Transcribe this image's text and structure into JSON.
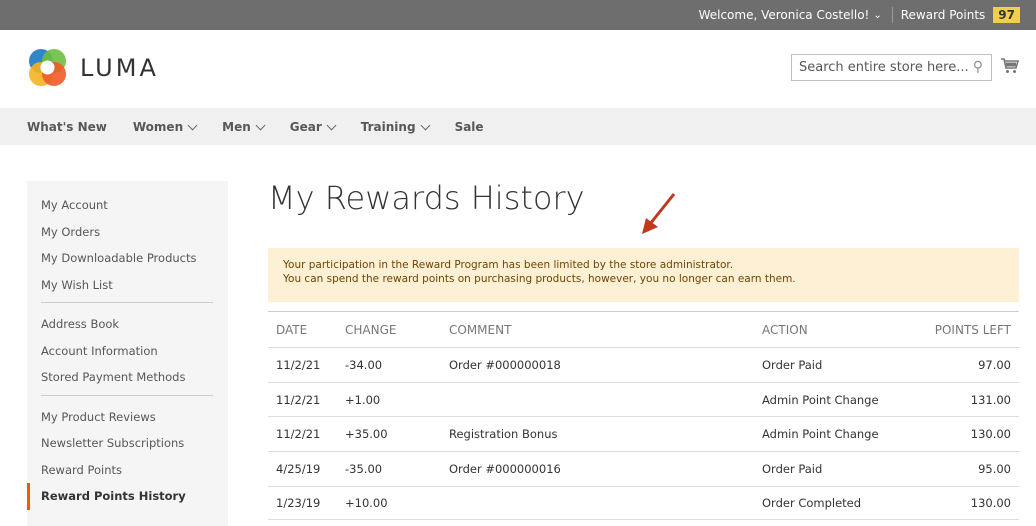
{
  "topbar": {
    "welcome": "Welcome, Veronica Costello!",
    "reward_points_label": "Reward Points",
    "reward_points_value": "97"
  },
  "header": {
    "logo_text": "LUMA",
    "search_placeholder": "Search entire store here..."
  },
  "nav": {
    "items": [
      "What's New",
      "Women",
      "Men",
      "Gear",
      "Training",
      "Sale"
    ]
  },
  "sidebar": {
    "group1": [
      "My Account",
      "My Orders",
      "My Downloadable Products",
      "My Wish List"
    ],
    "group2": [
      "Address Book",
      "Account Information",
      "Stored Payment Methods"
    ],
    "group3": [
      "My Product Reviews",
      "Newsletter Subscriptions",
      "Reward Points",
      "Reward Points History"
    ]
  },
  "main": {
    "title": "My Rewards History",
    "notice_line1": "Your participation in the Reward Program has been limited by the store administrator.",
    "notice_line2": "You can spend the reward points on purchasing products, however, you no longer can earn them."
  },
  "table": {
    "headers": [
      "DATE",
      "CHANGE",
      "COMMENT",
      "ACTION",
      "POINTS LEFT"
    ],
    "rows": [
      {
        "date": "11/2/21",
        "change": "-34.00",
        "comment": "Order #000000018",
        "action": "Order Paid",
        "points": "97.00"
      },
      {
        "date": "11/2/21",
        "change": "+1.00",
        "comment": "",
        "action": "Admin Point Change",
        "points": "131.00"
      },
      {
        "date": "11/2/21",
        "change": "+35.00",
        "comment": "Registration Bonus",
        "action": "Admin Point Change",
        "points": "130.00"
      },
      {
        "date": "4/25/19",
        "change": "-35.00",
        "comment": "Order #000000016",
        "action": "Order Paid",
        "points": "95.00"
      },
      {
        "date": "1/23/19",
        "change": "+10.00",
        "comment": "",
        "action": "Order Completed",
        "points": "130.00"
      }
    ]
  },
  "colors": {
    "topbar": "#6e6e6e",
    "badge": "#f0d04a",
    "active_accent": "#ff5501",
    "notice_bg": "#fdf0d5",
    "arrow": "#c0391b"
  }
}
